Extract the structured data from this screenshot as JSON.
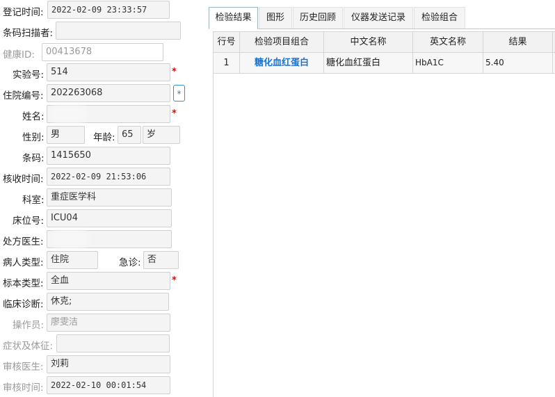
{
  "form": {
    "register_time": {
      "label": "登记时间:",
      "value": "2022-02-09 23:33:57"
    },
    "barcode_scanner": {
      "label": "条码扫描者:",
      "value": ""
    },
    "health_id": {
      "label": "健康ID:",
      "value": "00413678"
    },
    "lab_no": {
      "label": "实验号:",
      "value": "514",
      "required": "*"
    },
    "inpatient_no": {
      "label": "住院编号:",
      "value": "202263068",
      "button": "*"
    },
    "name": {
      "label": "姓名:",
      "value": "",
      "required": "*"
    },
    "gender": {
      "label": "性别:",
      "value": "男"
    },
    "age": {
      "label": "年龄:",
      "value": "65",
      "unit": "岁"
    },
    "barcode": {
      "label": "条码:",
      "value": "1415650"
    },
    "receive_time": {
      "label": "核收时间:",
      "value": "2022-02-09 21:53:06"
    },
    "department": {
      "label": "科室:",
      "value": "重症医学科"
    },
    "bed_no": {
      "label": "床位号:",
      "value": "ICU04"
    },
    "prescribing_doctor": {
      "label": "处方医生:",
      "value": ""
    },
    "patient_type": {
      "label": "病人类型:",
      "value": "住院"
    },
    "emergency": {
      "label": "急诊:",
      "value": "否"
    },
    "specimen_type": {
      "label": "标本类型:",
      "value": "全血",
      "required": "*"
    },
    "clinical_diagnosis": {
      "label": "临床诊断:",
      "value": "休克;"
    },
    "operator": {
      "label": "操作员:",
      "value": "廖雯洁"
    },
    "symptoms": {
      "label": "症状及体征:",
      "value": ""
    },
    "reviewer": {
      "label": "审核医生:",
      "value": "刘莉"
    },
    "review_time": {
      "label": "审核时间:",
      "value": "2022-02-10 00:01:54"
    }
  },
  "tabs": [
    "检验结果",
    "图形",
    "历史回顾",
    "仪器发送记录",
    "检验组合"
  ],
  "table": {
    "columns": [
      "行号",
      "检验项目组合",
      "中文名称",
      "英文名称",
      "结果"
    ],
    "rows": [
      [
        "1",
        "糖化血红蛋白",
        "糖化血红蛋白",
        "HbA1C",
        "5.40"
      ]
    ]
  }
}
